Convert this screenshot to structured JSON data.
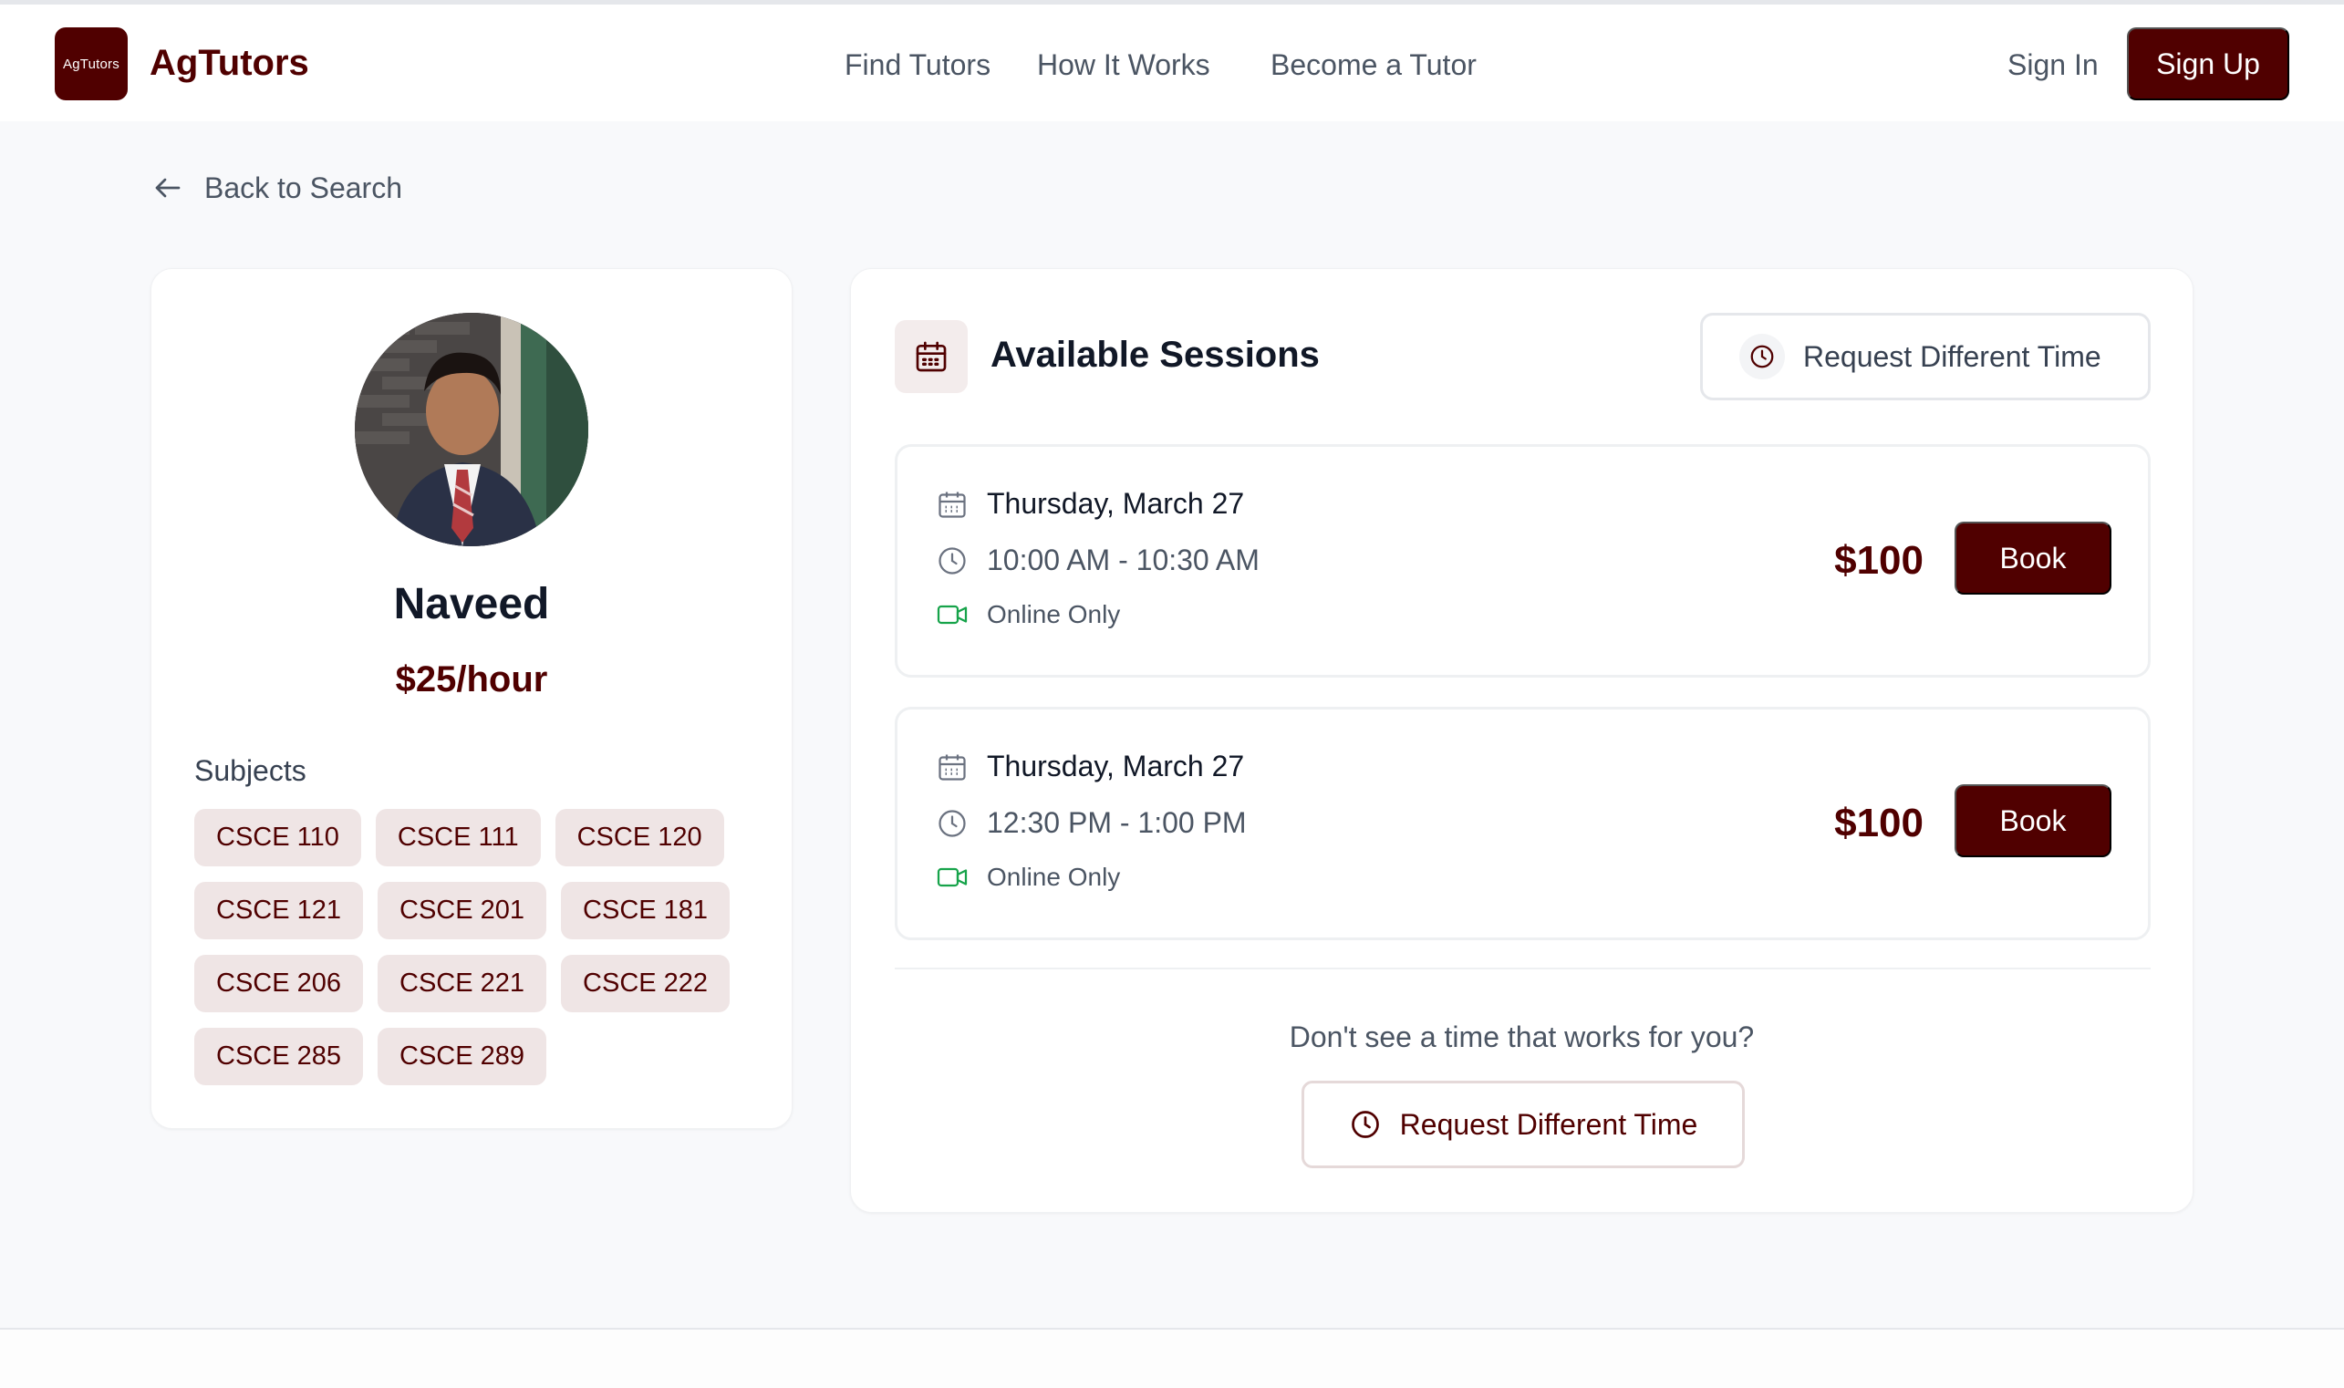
{
  "header": {
    "logo_text": "AgTutors",
    "brand": "AgTutors",
    "nav": [
      "Find Tutors",
      "How It Works",
      "Become a Tutor"
    ],
    "sign_in": "Sign In",
    "sign_up": "Sign Up"
  },
  "back_link": "Back to Search",
  "tutor": {
    "name": "Naveed",
    "rate": "$25/hour",
    "subjects_label": "Subjects",
    "subjects": [
      "CSCE 110",
      "CSCE 111",
      "CSCE 120",
      "CSCE 121",
      "CSCE 201",
      "CSCE 181",
      "CSCE 206",
      "CSCE 221",
      "CSCE 222",
      "CSCE 285",
      "CSCE 289"
    ]
  },
  "sessions": {
    "title": "Available Sessions",
    "request_button": "Request Different Time",
    "items": [
      {
        "date": "Thursday, March 27",
        "time": "10:00 AM - 10:30 AM",
        "mode": "Online Only",
        "price": "$100",
        "book_label": "Book"
      },
      {
        "date": "Thursday, March 27",
        "time": "12:30 PM - 1:00 PM",
        "mode": "Online Only",
        "price": "$100",
        "book_label": "Book"
      }
    ],
    "cta_text": "Don't see a time that works for you?",
    "cta_button": "Request Different Time"
  },
  "colors": {
    "brand": "#500000",
    "chip_bg": "#efe5e5",
    "online_icon": "#16a34a"
  }
}
